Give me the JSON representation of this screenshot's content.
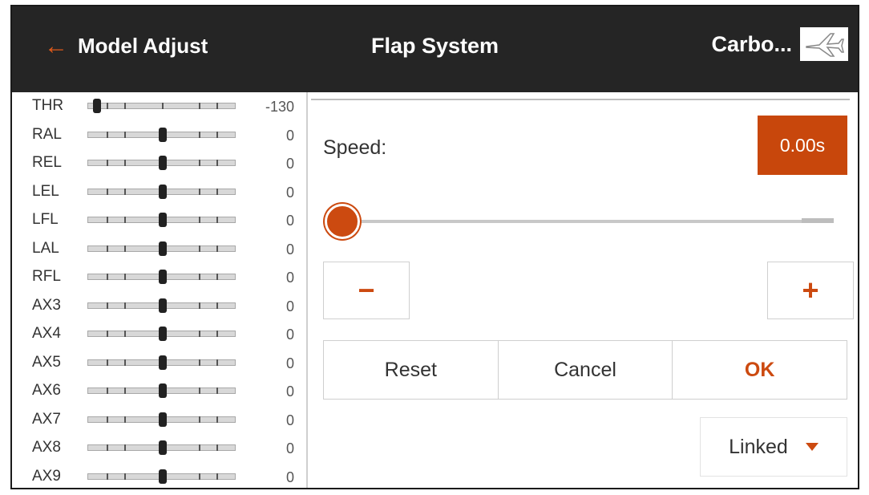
{
  "header": {
    "back_label": "Model Adjust",
    "title": "Flap System",
    "model_name": "Carbo...",
    "model_icon": "airplane-icon"
  },
  "channels": [
    {
      "label": "THR",
      "value": "-130",
      "position": 0.06
    },
    {
      "label": "RAL",
      "value": "0",
      "position": 0.5
    },
    {
      "label": "REL",
      "value": "0",
      "position": 0.5
    },
    {
      "label": "LEL",
      "value": "0",
      "position": 0.5
    },
    {
      "label": "LFL",
      "value": "0",
      "position": 0.5
    },
    {
      "label": "LAL",
      "value": "0",
      "position": 0.5
    },
    {
      "label": "RFL",
      "value": "0",
      "position": 0.5
    },
    {
      "label": "AX3",
      "value": "0",
      "position": 0.5
    },
    {
      "label": "AX4",
      "value": "0",
      "position": 0.5
    },
    {
      "label": "AX5",
      "value": "0",
      "position": 0.5
    },
    {
      "label": "AX6",
      "value": "0",
      "position": 0.5
    },
    {
      "label": "AX7",
      "value": "0",
      "position": 0.5
    },
    {
      "label": "AX8",
      "value": "0",
      "position": 0.5
    },
    {
      "label": "AX9",
      "value": "0",
      "position": 0.5
    }
  ],
  "speed": {
    "label": "Speed:",
    "value": "0.00s",
    "slider_fraction": 0
  },
  "buttons": {
    "minus": "−",
    "plus": "+",
    "reset": "Reset",
    "cancel": "Cancel",
    "ok": "OK"
  },
  "dropdown": {
    "selected": "Linked"
  },
  "colors": {
    "accent": "#cc4a10",
    "header_bg": "#252525"
  }
}
